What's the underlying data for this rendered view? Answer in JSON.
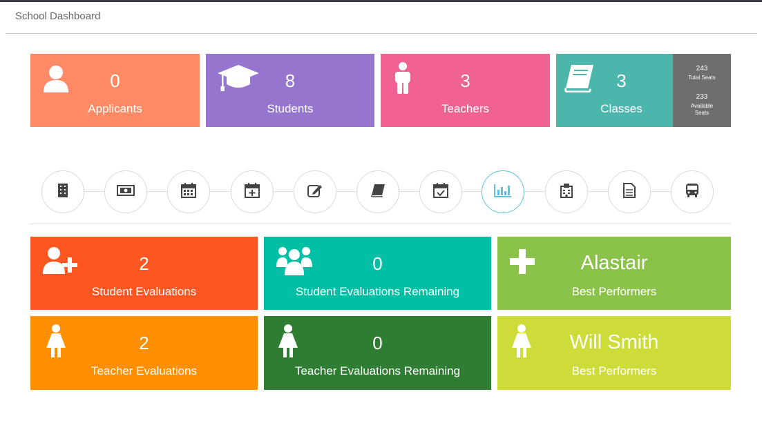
{
  "page": {
    "title": "School Dashboard"
  },
  "stats": [
    {
      "icon": "user-icon",
      "value": "0",
      "label": "Applicants",
      "color": "#ff8a65"
    },
    {
      "icon": "graduation-cap-icon",
      "value": "8",
      "label": "Students",
      "color": "#9575cd"
    },
    {
      "icon": "male-icon",
      "value": "3",
      "label": "Teachers",
      "color": "#f06292"
    },
    {
      "icon": "book-icon",
      "value": "3",
      "label": "Classes",
      "color": "#4db6ac",
      "seats": {
        "total": "243",
        "total_label": "Total Seats",
        "available": "233",
        "available_label": "Available Seats"
      }
    }
  ],
  "steps": [
    {
      "icon": "building-icon"
    },
    {
      "icon": "money-icon"
    },
    {
      "icon": "calendar-icon"
    },
    {
      "icon": "calendar-plus-icon"
    },
    {
      "icon": "edit-icon"
    },
    {
      "icon": "book-icon"
    },
    {
      "icon": "calendar-check-icon"
    },
    {
      "icon": "bar-chart-icon",
      "active": true
    },
    {
      "icon": "hospital-icon"
    },
    {
      "icon": "file-text-icon"
    },
    {
      "icon": "bus-icon"
    }
  ],
  "evaluations": [
    {
      "icon": "user-plus-icon",
      "value": "2",
      "label": "Student Evaluations",
      "color": "#ff5722"
    },
    {
      "icon": "users-icon",
      "value": "0",
      "label": "Student Evaluations Remaining",
      "color": "#00bfa5"
    },
    {
      "icon": "plus-icon",
      "value": "Alastair",
      "label": "Best Performers",
      "color": "#8bc34a"
    },
    {
      "icon": "female-icon",
      "value": "2",
      "label": "Teacher Evaluations",
      "color": "#ff8f00"
    },
    {
      "icon": "female-icon",
      "value": "0",
      "label": "Teacher Evaluations Remaining",
      "color": "#2e7d32"
    },
    {
      "icon": "female-icon",
      "value": "Will Smith",
      "label": "Best Performers",
      "color": "#cddc39"
    }
  ]
}
